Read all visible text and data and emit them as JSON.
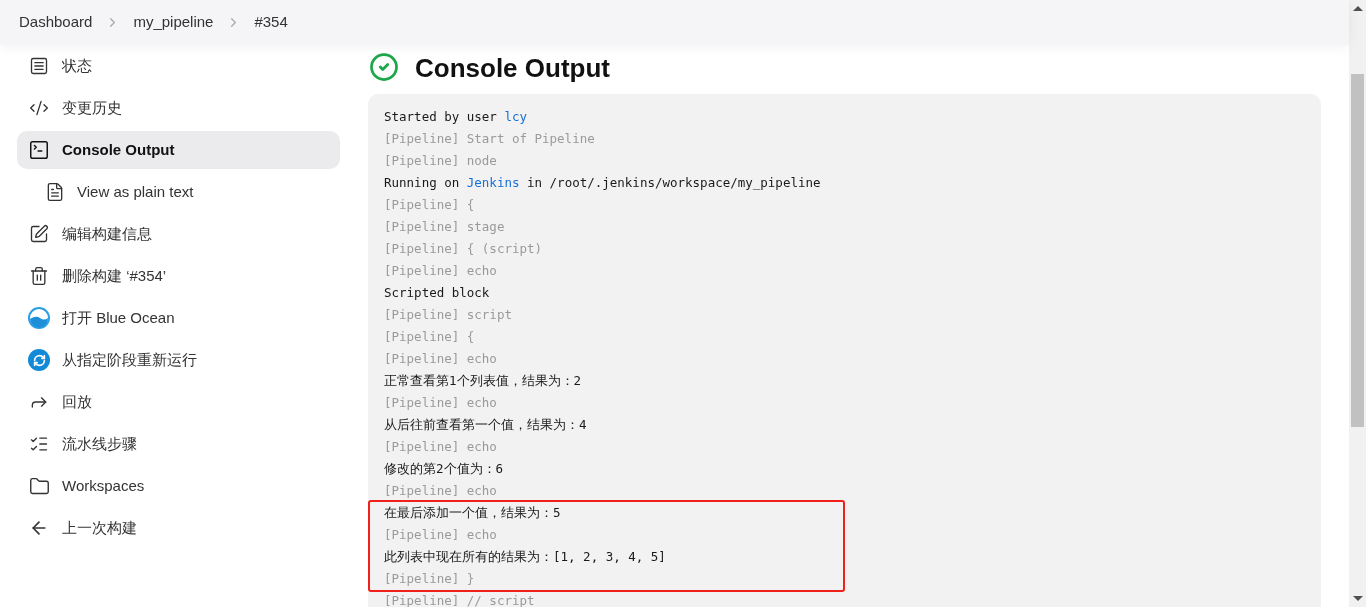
{
  "breadcrumbs": [
    "Dashboard",
    "my_pipeline",
    "#354"
  ],
  "sidebar": {
    "items": [
      {
        "label": "状态",
        "selected": false
      },
      {
        "label": "变更历史",
        "selected": false
      },
      {
        "label": "Console Output",
        "selected": true,
        "children": [
          {
            "label": "View as plain text",
            "selected": false
          }
        ]
      },
      {
        "label": "编辑构建信息",
        "selected": false
      },
      {
        "label": "删除构建 ‘#354’",
        "selected": false
      },
      {
        "label": "打开 Blue Ocean",
        "selected": false
      },
      {
        "label": "从指定阶段重新运行",
        "selected": false
      },
      {
        "label": "回放",
        "selected": false
      },
      {
        "label": "流水线步骤",
        "selected": false
      },
      {
        "label": "Workspaces",
        "selected": false
      },
      {
        "label": "上一次构建",
        "selected": false
      }
    ]
  },
  "title": "Console Output",
  "console": {
    "lines": [
      {
        "kind": "text",
        "highlighted": false,
        "segments": [
          {
            "kind": "text",
            "text": "Started by user "
          },
          {
            "kind": "link",
            "text": "lcy"
          }
        ]
      },
      {
        "kind": "pipeline",
        "highlighted": false,
        "segments": [
          {
            "kind": "text",
            "text": "[Pipeline] Start of Pipeline"
          }
        ]
      },
      {
        "kind": "pipeline",
        "highlighted": false,
        "segments": [
          {
            "kind": "text",
            "text": "[Pipeline] node"
          }
        ]
      },
      {
        "kind": "text",
        "highlighted": false,
        "segments": [
          {
            "kind": "text",
            "text": "Running on "
          },
          {
            "kind": "link",
            "text": "Jenkins"
          },
          {
            "kind": "text",
            "text": " in /root/.jenkins/workspace/my_pipeline"
          }
        ]
      },
      {
        "kind": "pipeline",
        "highlighted": false,
        "segments": [
          {
            "kind": "text",
            "text": "[Pipeline] {"
          }
        ]
      },
      {
        "kind": "pipeline",
        "highlighted": false,
        "segments": [
          {
            "kind": "text",
            "text": "[Pipeline] stage"
          }
        ]
      },
      {
        "kind": "pipeline",
        "highlighted": false,
        "segments": [
          {
            "kind": "text",
            "text": "[Pipeline] { (script)"
          }
        ]
      },
      {
        "kind": "pipeline",
        "highlighted": false,
        "segments": [
          {
            "kind": "text",
            "text": "[Pipeline] echo"
          }
        ]
      },
      {
        "kind": "text",
        "highlighted": false,
        "segments": [
          {
            "kind": "text",
            "text": "Scripted block"
          }
        ]
      },
      {
        "kind": "pipeline",
        "highlighted": false,
        "segments": [
          {
            "kind": "text",
            "text": "[Pipeline] script"
          }
        ]
      },
      {
        "kind": "pipeline",
        "highlighted": false,
        "segments": [
          {
            "kind": "text",
            "text": "[Pipeline] {"
          }
        ]
      },
      {
        "kind": "pipeline",
        "highlighted": false,
        "segments": [
          {
            "kind": "text",
            "text": "[Pipeline] echo"
          }
        ]
      },
      {
        "kind": "text",
        "highlighted": false,
        "segments": [
          {
            "kind": "text",
            "text": "正常查看第1个列表值，结果为：2"
          }
        ]
      },
      {
        "kind": "pipeline",
        "highlighted": false,
        "segments": [
          {
            "kind": "text",
            "text": "[Pipeline] echo"
          }
        ]
      },
      {
        "kind": "text",
        "highlighted": false,
        "segments": [
          {
            "kind": "text",
            "text": "从后往前查看第一个值，结果为：4"
          }
        ]
      },
      {
        "kind": "pipeline",
        "highlighted": false,
        "segments": [
          {
            "kind": "text",
            "text": "[Pipeline] echo"
          }
        ]
      },
      {
        "kind": "text",
        "highlighted": false,
        "segments": [
          {
            "kind": "text",
            "text": "修改的第2个值为：6"
          }
        ]
      },
      {
        "kind": "pipeline",
        "highlighted": false,
        "segments": [
          {
            "kind": "text",
            "text": "[Pipeline] echo"
          }
        ]
      },
      {
        "kind": "text",
        "highlighted": true,
        "segments": [
          {
            "kind": "text",
            "text": "在最后添加一个值，结果为：5"
          }
        ]
      },
      {
        "kind": "pipeline",
        "highlighted": true,
        "segments": [
          {
            "kind": "text",
            "text": "[Pipeline] echo"
          }
        ]
      },
      {
        "kind": "text",
        "highlighted": true,
        "segments": [
          {
            "kind": "text",
            "text": "此列表中现在所有的结果为：[1, 2, 3, 4, 5]"
          }
        ]
      },
      {
        "kind": "pipeline",
        "highlighted": true,
        "segments": [
          {
            "kind": "text",
            "text": "[Pipeline] }"
          }
        ]
      },
      {
        "kind": "pipeline",
        "highlighted": false,
        "segments": [
          {
            "kind": "text",
            "text": "[Pipeline] // script"
          }
        ]
      }
    ]
  }
}
